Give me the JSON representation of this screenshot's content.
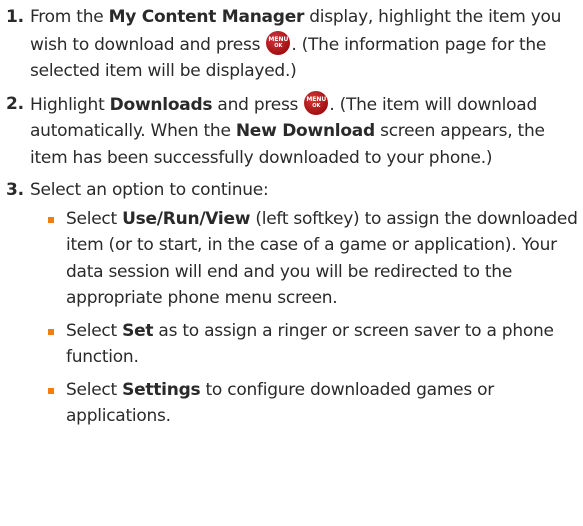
{
  "button": {
    "line1": "MENU",
    "line2": "OK"
  },
  "step1": {
    "num": "1.",
    "t1": "From the ",
    "b1": "My Content Manager",
    "t2": " display, highlight the item you wish to download and press ",
    "t3": ". (The information page for the selected item will be displayed.)"
  },
  "step2": {
    "num": "2.",
    "t1": "Highlight ",
    "b1": "Downloads",
    "t2": " and press ",
    "t3": ". (The item will download automatically. When the ",
    "b2": "New Download",
    "t4": " screen appears, the item has been successfully downloaded to your phone.)"
  },
  "step3": {
    "num": "3.",
    "text": "Select an option to continue:",
    "options": [
      {
        "t1": "Select ",
        "b1": "Use/Run/View",
        "t2": " (left softkey) to assign the downloaded item (or to start, in the case of a game or application). Your data session will end and you will be redirected to the appropriate phone menu screen."
      },
      {
        "t1": "Select ",
        "b1": "Set",
        "t2": " as to assign a ringer or screen saver to a phone function."
      },
      {
        "t1": "Select ",
        "b1": "Settings",
        "t2": " to configure downloaded games or applications."
      }
    ]
  },
  "colors": {
    "bullet": "#f27d11",
    "button": "#a30f12",
    "text": "#2a2a2a"
  }
}
